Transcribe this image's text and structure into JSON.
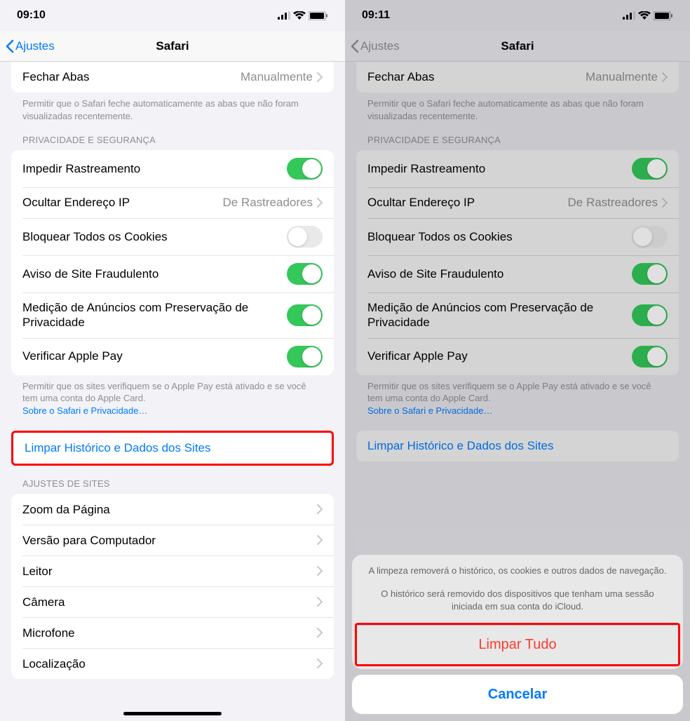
{
  "left": {
    "status_time": "09:10",
    "back_label": "Ajustes",
    "title": "Safari",
    "close_tabs": {
      "label": "Fechar Abas",
      "value": "Manualmente"
    },
    "close_tabs_footer": "Permitir que o Safari feche automaticamente as abas que não foram visualizadas recentemente.",
    "privacy_header": "PRIVACIDADE E SEGURANÇA",
    "prevent_tracking": "Impedir Rastreamento",
    "hide_ip": {
      "label": "Ocultar Endereço IP",
      "value": "De Rastreadores"
    },
    "block_cookies": "Bloquear Todos os Cookies",
    "fraud_warning": "Aviso de Site Fraudulento",
    "ad_measurement": "Medição de Anúncios com Preservação de Privacidade",
    "verify_apple_pay": "Verificar Apple Pay",
    "apple_pay_footer": "Permitir que os sites verifiquem se o Apple Pay está ativado e se você tem uma conta do Apple Card.",
    "privacy_link": "Sobre o Safari e Privacidade…",
    "clear_history": "Limpar Histórico e Dados dos Sites",
    "sites_header": "AJUSTES DE SITES",
    "page_zoom": "Zoom da Página",
    "desktop_version": "Versão para Computador",
    "reader": "Leitor",
    "camera": "Câmera",
    "microphone": "Microfone",
    "location": "Localização"
  },
  "right": {
    "status_time": "09:11",
    "back_label": "Ajustes",
    "title": "Safari",
    "close_tabs": {
      "label": "Fechar Abas",
      "value": "Manualmente"
    },
    "close_tabs_footer": "Permitir que o Safari feche automaticamente as abas que não foram visualizadas recentemente.",
    "privacy_header": "PRIVACIDADE E SEGURANÇA",
    "prevent_tracking": "Impedir Rastreamento",
    "hide_ip": {
      "label": "Ocultar Endereço IP",
      "value": "De Rastreadores"
    },
    "block_cookies": "Bloquear Todos os Cookies",
    "fraud_warning": "Aviso de Site Fraudulento",
    "ad_measurement": "Medição de Anúncios com Preservação de Privacidade",
    "verify_apple_pay": "Verificar Apple Pay",
    "apple_pay_footer": "Permitir que os sites verifiquem se o Apple Pay está ativado e se você tem uma conta do Apple Card.",
    "privacy_link": "Sobre o Safari e Privacidade…",
    "clear_history": "Limpar Histórico e Dados dos Sites",
    "sheet_msg1": "A limpeza removerá o histórico, os cookies e outros dados de navegação.",
    "sheet_msg2": "O histórico será removido dos dispositivos que tenham uma sessão iniciada em sua conta do iCloud.",
    "clear_all": "Limpar Tudo",
    "cancel": "Cancelar"
  }
}
